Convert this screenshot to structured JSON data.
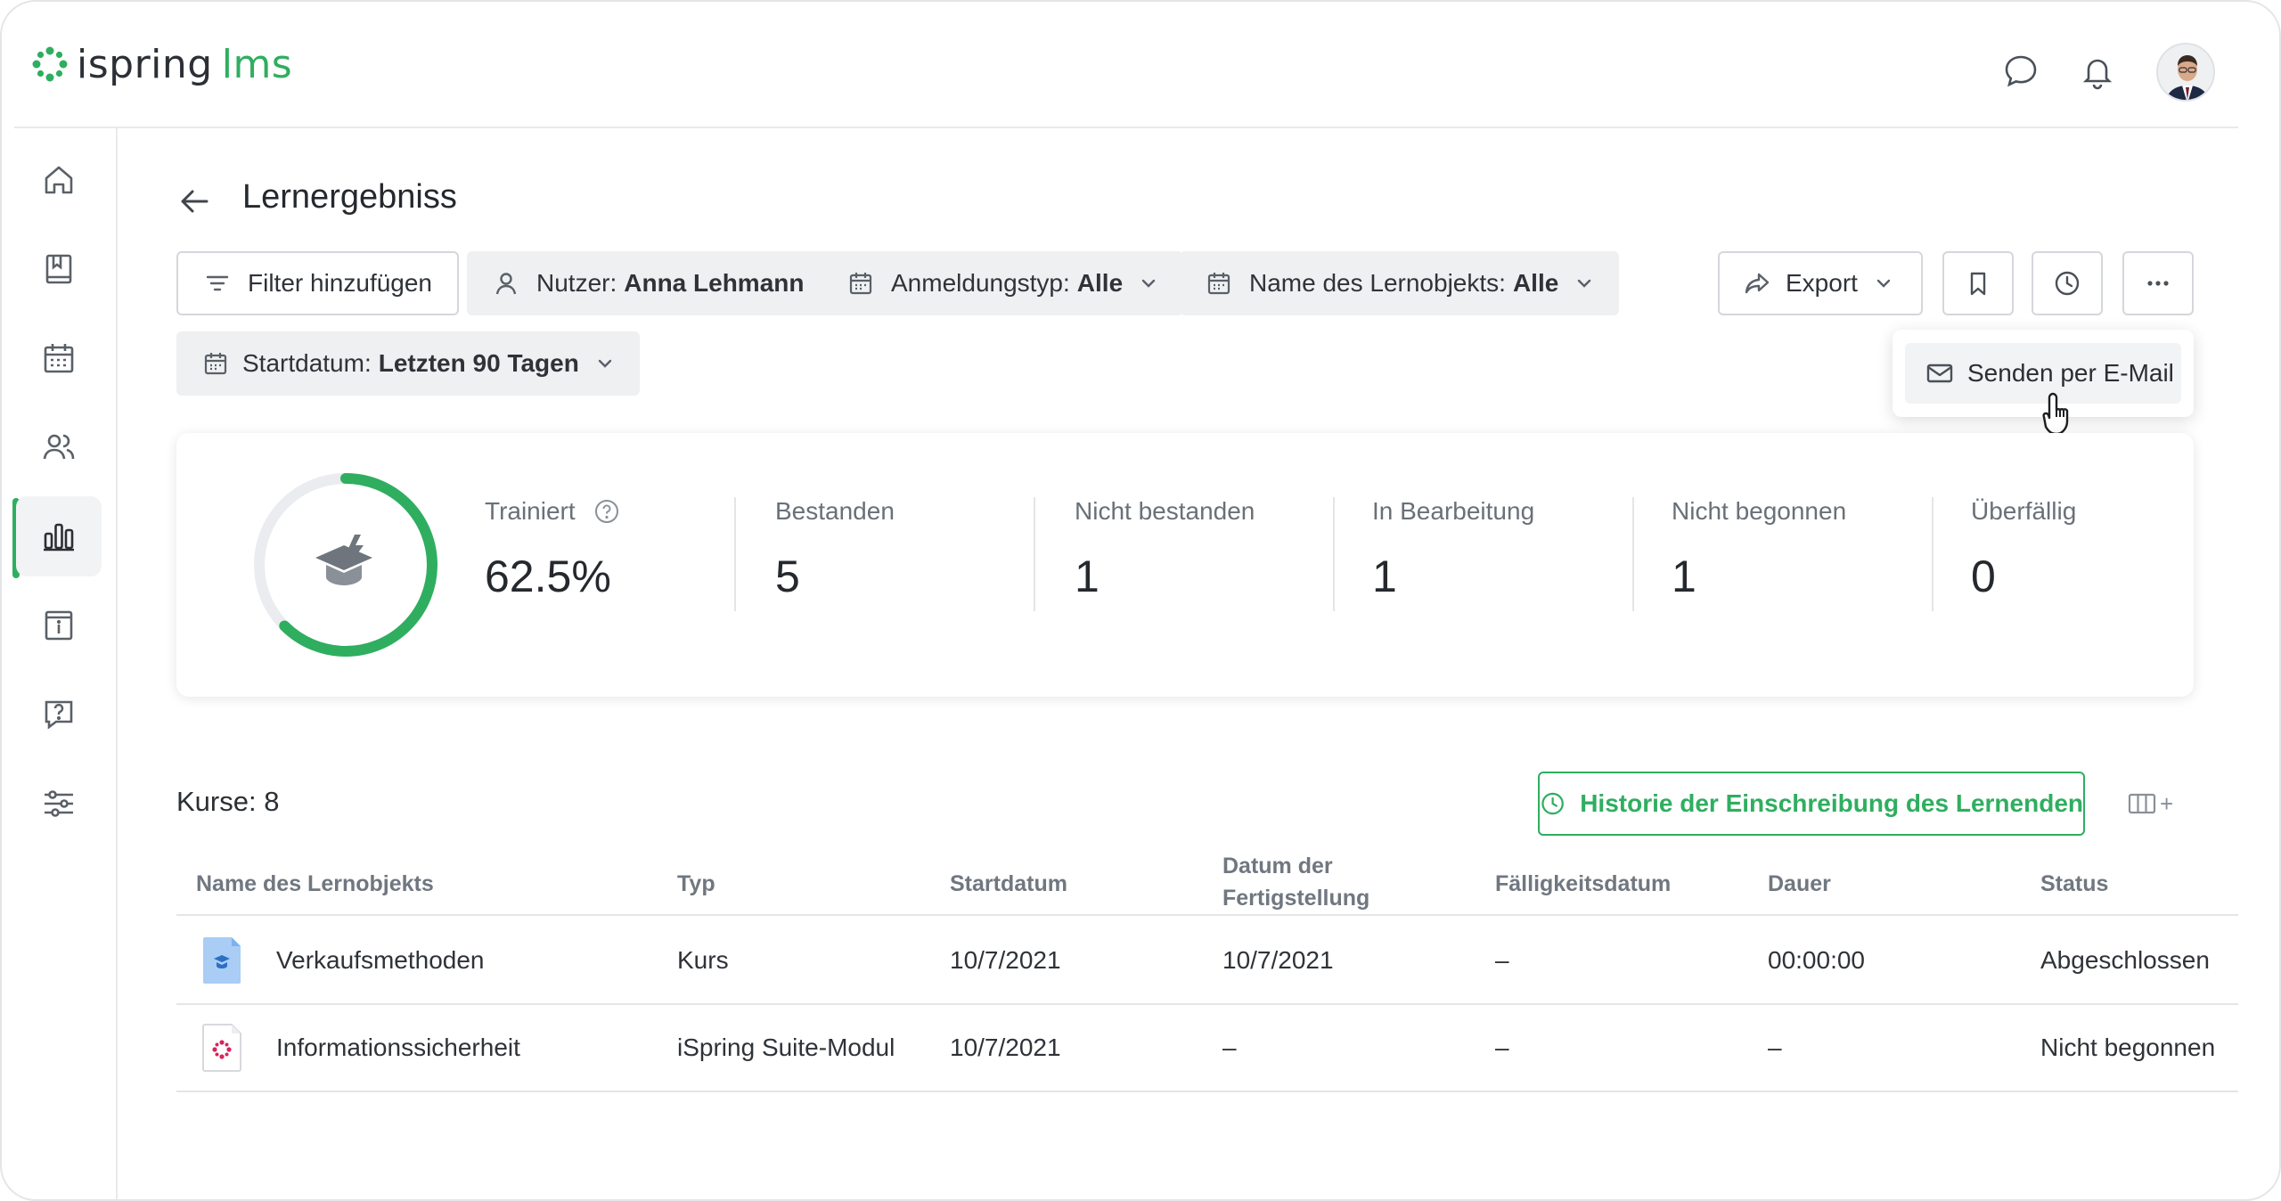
{
  "header": {
    "logo_prefix": "ispring",
    "logo_suffix": "lms",
    "icons": [
      "chat-icon",
      "bell-icon"
    ],
    "brand_color": "#2fae60"
  },
  "sidebar": {
    "items": [
      {
        "icon": "home-icon"
      },
      {
        "icon": "book-icon"
      },
      {
        "icon": "calendar-icon"
      },
      {
        "icon": "users-icon"
      },
      {
        "icon": "reports-icon",
        "active": true
      },
      {
        "icon": "info-icon"
      },
      {
        "icon": "question-icon"
      },
      {
        "icon": "settings-sliders-icon"
      }
    ]
  },
  "page": {
    "title": "Lernergebniss"
  },
  "filters": {
    "add_filter": "Filter hinzufügen",
    "user_label": "Nutzer:",
    "user_value": "Anna Lehmann",
    "enroll_label": "Anmeldungstyp:",
    "enroll_value": "Alle",
    "object_label": "Name des Lernobjekts:",
    "object_value": "Alle",
    "start_label": "Startdatum:",
    "start_value": "Letzten 90 Tagen"
  },
  "toolbar": {
    "export_label": "Export",
    "popup_item": "Senden per E-Mail"
  },
  "stats": {
    "trained": {
      "label": "Trainiert",
      "value": "62.5%",
      "progress": 0.625
    },
    "passed": {
      "label": "Bestanden",
      "value": "5"
    },
    "failed": {
      "label": "Nicht bestanden",
      "value": "1"
    },
    "in_progress": {
      "label": "In Bearbeitung",
      "value": "1"
    },
    "not_started": {
      "label": "Nicht begonnen",
      "value": "1"
    },
    "overdue": {
      "label": "Überfällig",
      "value": "0"
    }
  },
  "table": {
    "count_label": "Kurse: 8",
    "history_button": "Historie der Einschreibung des Lernenden",
    "columns_button": "+",
    "headers": {
      "name": "Name des Lernobjekts",
      "type": "Typ",
      "start": "Startdatum",
      "completion_line1": "Datum der",
      "completion_line2": "Fertigstellung",
      "due": "Fälligkeitsdatum",
      "duration": "Dauer",
      "status": "Status"
    },
    "rows": [
      {
        "name": "Verkaufsmethoden",
        "type": "Kurs",
        "start": "10/7/2021",
        "completion": "10/7/2021",
        "due": "–",
        "duration": "00:00:00",
        "status": "Abgeschlossen",
        "icon": "course-file-icon"
      },
      {
        "name": "Informationssicherheit",
        "type": "iSpring Suite-Modul",
        "start": "10/7/2021",
        "completion": "–",
        "due": "–",
        "duration": "–",
        "status": "Nicht begonnen",
        "icon": "ispring-module-icon"
      }
    ]
  }
}
